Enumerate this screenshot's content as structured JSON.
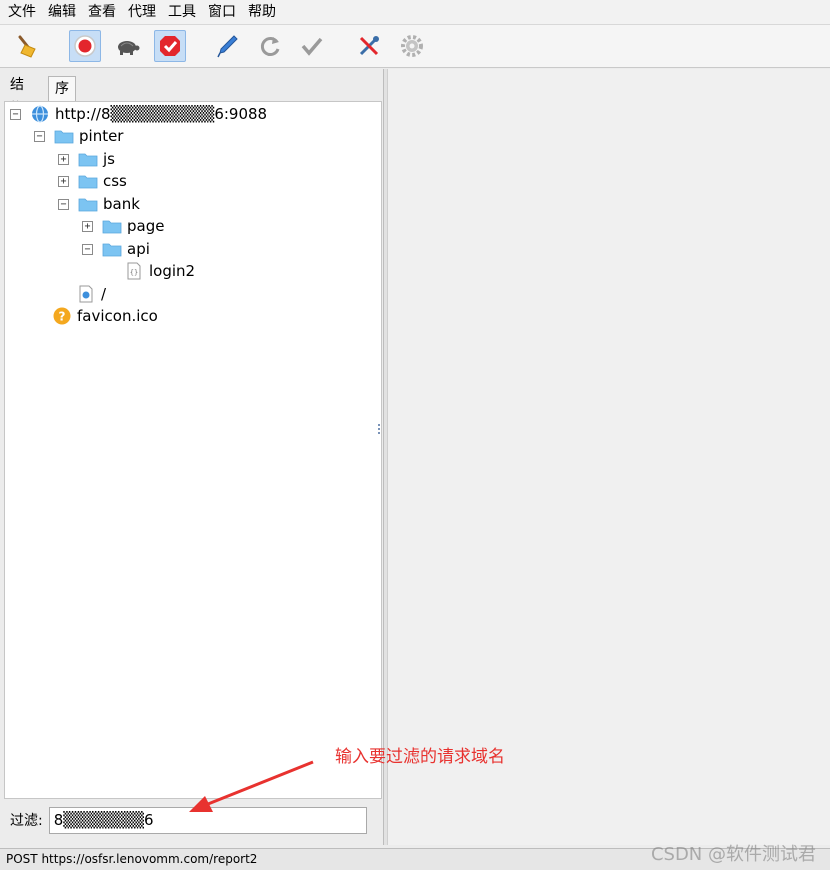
{
  "menu": [
    "文件",
    "编辑",
    "查看",
    "代理",
    "工具",
    "窗口",
    "帮助"
  ],
  "toolbar": {
    "icons": [
      "broom-icon",
      "record-icon",
      "throttle-turtle-icon",
      "breakpoint-icon",
      "edit-pen-icon",
      "repeat-icon",
      "validate-check-icon",
      "tools-icon",
      "settings-gear-icon"
    ],
    "active": [
      "record-icon",
      "breakpoint-icon"
    ]
  },
  "tabs": {
    "structure": "结构",
    "sequence": "序列"
  },
  "tree": {
    "host": "http://8▒▒▒▒▒▒▒▒▒6:9088",
    "pinter": "pinter",
    "js": "js",
    "css": "css",
    "bank": "bank",
    "page": "page",
    "api": "api",
    "login2": "login2",
    "root": "/",
    "favicon": "favicon.ico"
  },
  "filter": {
    "label": "过滤:",
    "value": "8▒▒▒▒▒▒▒6"
  },
  "annotation": "输入要过滤的请求域名",
  "status": "POST https://osfsr.lenovomm.com/report2",
  "watermark": "CSDN @软件测试君",
  "colors": {
    "annotation": "#e8322f",
    "folder": "#7cc4f2",
    "active_tool": "#c7def6"
  }
}
